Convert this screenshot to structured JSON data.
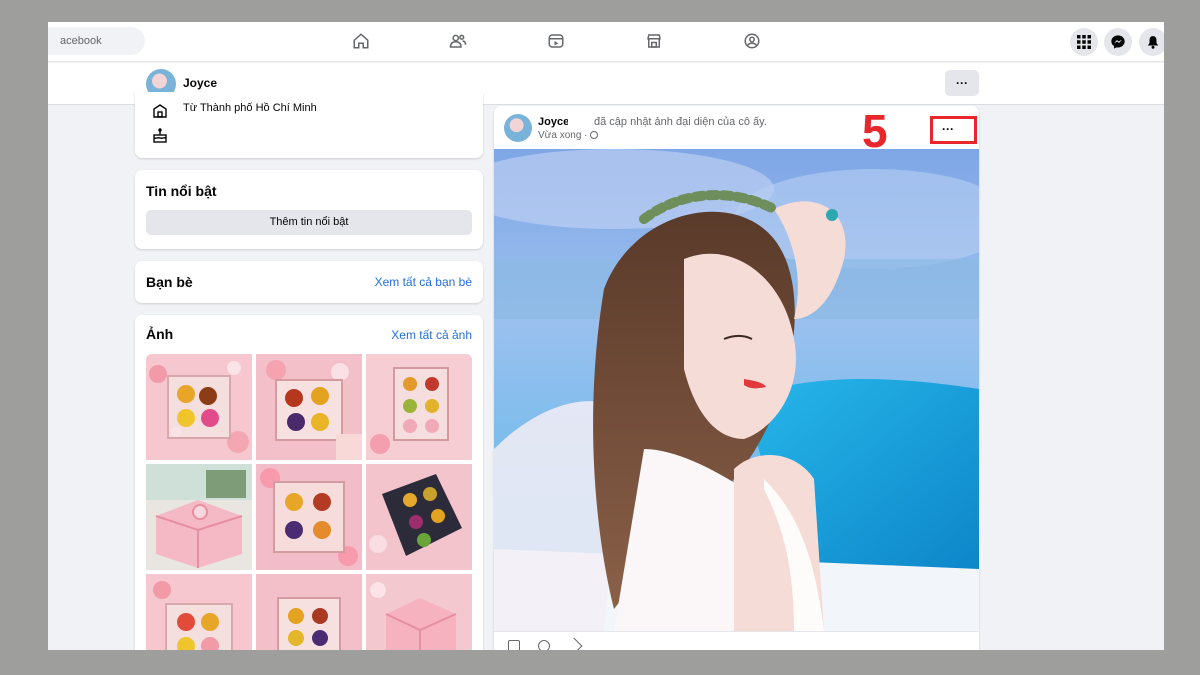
{
  "colors": {
    "accent": "#216fdb",
    "annotation": "#e8262b",
    "page_bg": "#f0f2f5",
    "frame_bg": "#9e9e9c"
  },
  "topnav": {
    "search_text": "acebook",
    "nav_icons": [
      "home-icon",
      "friends-icon",
      "video-icon",
      "marketplace-icon",
      "groups-icon"
    ],
    "right_icons": [
      "menu-grid-icon",
      "messenger-icon",
      "notifications-icon"
    ]
  },
  "profile_header": {
    "name": "Joyce",
    "more_label": "···"
  },
  "intro": {
    "location": "Từ Thành phố Hồ Chí Minh",
    "icons": [
      "location-icon",
      "birthday-icon"
    ]
  },
  "featured": {
    "title": "Tin nổi bật",
    "button_label": "Thêm tin nổi bật"
  },
  "friends": {
    "title": "Bạn bè",
    "see_all": "Xem tất cả bạn bè"
  },
  "photos": {
    "title": "Ảnh",
    "see_all": "Xem tất cả ảnh"
  },
  "post": {
    "author": "Joyce",
    "action": "đã cập nhật ảnh đại diện của cô ấy.",
    "time": "Vừa xong ·",
    "more_label": "···",
    "bar_icons": [
      "like-icon",
      "comment-icon",
      "share-icon"
    ]
  },
  "annotation": {
    "step": "5"
  }
}
